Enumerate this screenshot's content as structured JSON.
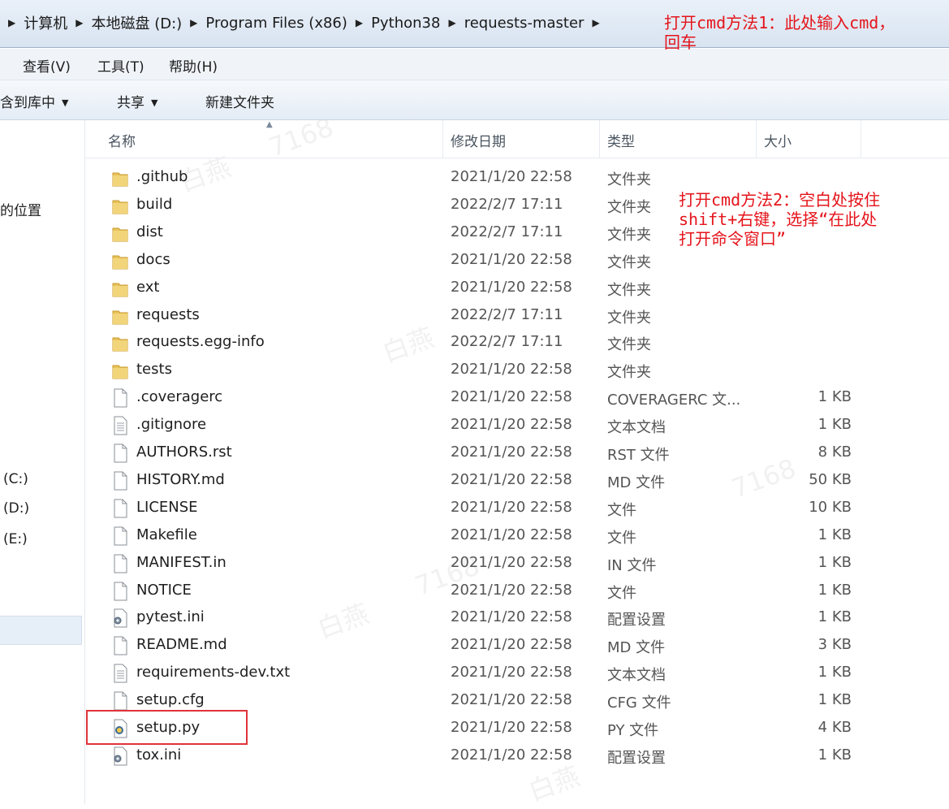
{
  "breadcrumb": [
    {
      "label": "计算机"
    },
    {
      "label": "本地磁盘 (D:)"
    },
    {
      "label": "Program Files (x86)"
    },
    {
      "label": "Python38"
    },
    {
      "label": "requests-master"
    }
  ],
  "menu": {
    "view": "查看(V)",
    "tools": "工具(T)",
    "help": "帮助(H)"
  },
  "toolbar": {
    "include_library": "含到库中",
    "share": "共享",
    "new_folder": "新建文件夹"
  },
  "nav": {
    "locations": "的位置",
    "drive_c": "(C:)",
    "drive_d": "(D:)",
    "drive_e": "(E:)"
  },
  "columns": {
    "name": "名称",
    "date": "修改日期",
    "type": "类型",
    "size": "大小"
  },
  "files": [
    {
      "name": ".github",
      "date": "2021/1/20 22:58",
      "type": "文件夹",
      "size": "",
      "icon": "folder-icon"
    },
    {
      "name": "build",
      "date": "2022/2/7 17:11",
      "type": "文件夹",
      "size": "",
      "icon": "folder-icon"
    },
    {
      "name": "dist",
      "date": "2022/2/7 17:11",
      "type": "文件夹",
      "size": "",
      "icon": "folder-icon"
    },
    {
      "name": "docs",
      "date": "2021/1/20 22:58",
      "type": "文件夹",
      "size": "",
      "icon": "folder-icon"
    },
    {
      "name": "ext",
      "date": "2021/1/20 22:58",
      "type": "文件夹",
      "size": "",
      "icon": "folder-icon"
    },
    {
      "name": "requests",
      "date": "2022/2/7 17:11",
      "type": "文件夹",
      "size": "",
      "icon": "folder-icon"
    },
    {
      "name": "requests.egg-info",
      "date": "2022/2/7 17:11",
      "type": "文件夹",
      "size": "",
      "icon": "folder-icon"
    },
    {
      "name": "tests",
      "date": "2021/1/20 22:58",
      "type": "文件夹",
      "size": "",
      "icon": "folder-icon"
    },
    {
      "name": ".coveragerc",
      "date": "2021/1/20 22:58",
      "type": "COVERAGERC 文...",
      "size": "1 KB",
      "icon": "file-icon"
    },
    {
      "name": ".gitignore",
      "date": "2021/1/20 22:58",
      "type": "文本文档",
      "size": "1 KB",
      "icon": "text-file-icon"
    },
    {
      "name": "AUTHORS.rst",
      "date": "2021/1/20 22:58",
      "type": "RST 文件",
      "size": "8 KB",
      "icon": "file-icon"
    },
    {
      "name": "HISTORY.md",
      "date": "2021/1/20 22:58",
      "type": "MD 文件",
      "size": "50 KB",
      "icon": "file-icon"
    },
    {
      "name": "LICENSE",
      "date": "2021/1/20 22:58",
      "type": "文件",
      "size": "10 KB",
      "icon": "file-icon"
    },
    {
      "name": "Makefile",
      "date": "2021/1/20 22:58",
      "type": "文件",
      "size": "1 KB",
      "icon": "file-icon"
    },
    {
      "name": "MANIFEST.in",
      "date": "2021/1/20 22:58",
      "type": "IN 文件",
      "size": "1 KB",
      "icon": "file-icon"
    },
    {
      "name": "NOTICE",
      "date": "2021/1/20 22:58",
      "type": "文件",
      "size": "1 KB",
      "icon": "file-icon"
    },
    {
      "name": "pytest.ini",
      "date": "2021/1/20 22:58",
      "type": "配置设置",
      "size": "1 KB",
      "icon": "settings-file-icon"
    },
    {
      "name": "README.md",
      "date": "2021/1/20 22:58",
      "type": "MD 文件",
      "size": "3 KB",
      "icon": "file-icon"
    },
    {
      "name": "requirements-dev.txt",
      "date": "2021/1/20 22:58",
      "type": "文本文档",
      "size": "1 KB",
      "icon": "text-file-icon"
    },
    {
      "name": "setup.cfg",
      "date": "2021/1/20 22:58",
      "type": "CFG 文件",
      "size": "1 KB",
      "icon": "file-icon"
    },
    {
      "name": "setup.py",
      "date": "2021/1/20 22:58",
      "type": "PY 文件",
      "size": "4 KB",
      "icon": "python-file-icon"
    },
    {
      "name": "tox.ini",
      "date": "2021/1/20 22:58",
      "type": "配置设置",
      "size": "1 KB",
      "icon": "settings-file-icon"
    }
  ],
  "annotations": {
    "method1_line1": "打开cmd方法1：此处输入cmd，",
    "method1_line2": "回车",
    "method2_line1": "打开cmd方法2：空白处按住",
    "method2_line2": "shift+右键，选择“在此处",
    "method2_line3": "打开命令窗口”"
  },
  "watermarks": {
    "text_a": "白燕",
    "text_b": "7168"
  },
  "colors": {
    "annotation_red": "#e4141b",
    "highlight_box": "#e0333a",
    "folder_yellow": "#e8c25a"
  }
}
